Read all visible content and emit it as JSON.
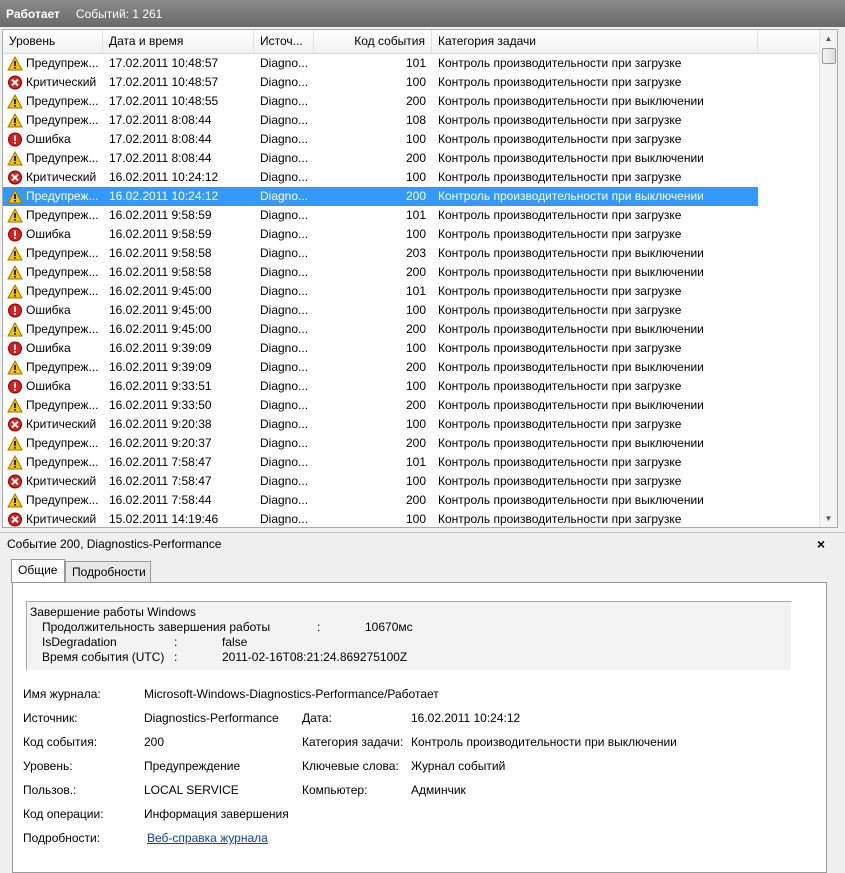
{
  "status": {
    "state": "Работает",
    "events": "Событий: 1 261"
  },
  "columns": [
    "Уровень",
    "Дата и время",
    "Источ...",
    "Код события",
    "Категория задачи"
  ],
  "rows": [
    {
      "level": "Предупреж...",
      "icon": "warning-icon",
      "date": "17.02.2011 10:48:57",
      "source": "Diagno...",
      "code": "101",
      "category": "Контроль производительности при загрузке"
    },
    {
      "level": "Критический",
      "icon": "critical-icon",
      "date": "17.02.2011 10:48:57",
      "source": "Diagno...",
      "code": "100",
      "category": "Контроль производительности при загрузке"
    },
    {
      "level": "Предупреж...",
      "icon": "warning-icon",
      "date": "17.02.2011 10:48:55",
      "source": "Diagno...",
      "code": "200",
      "category": "Контроль производительности при выключении"
    },
    {
      "level": "Предупреж...",
      "icon": "warning-icon",
      "date": "17.02.2011 8:08:44",
      "source": "Diagno...",
      "code": "108",
      "category": "Контроль производительности при загрузке"
    },
    {
      "level": "Ошибка",
      "icon": "error-icon",
      "date": "17.02.2011 8:08:44",
      "source": "Diagno...",
      "code": "100",
      "category": "Контроль производительности при загрузке"
    },
    {
      "level": "Предупреж...",
      "icon": "warning-icon",
      "date": "17.02.2011 8:08:44",
      "source": "Diagno...",
      "code": "200",
      "category": "Контроль производительности при выключении"
    },
    {
      "level": "Критический",
      "icon": "critical-icon",
      "date": "16.02.2011 10:24:12",
      "source": "Diagno...",
      "code": "100",
      "category": "Контроль производительности при загрузке"
    },
    {
      "level": "Предупреж...",
      "icon": "warning-icon",
      "date": "16.02.2011 10:24:12",
      "source": "Diagno...",
      "code": "200",
      "category": "Контроль производительности при выключении",
      "selected": true
    },
    {
      "level": "Предупреж...",
      "icon": "warning-icon",
      "date": "16.02.2011 9:58:59",
      "source": "Diagno...",
      "code": "101",
      "category": "Контроль производительности при загрузке"
    },
    {
      "level": "Ошибка",
      "icon": "error-icon",
      "date": "16.02.2011 9:58:59",
      "source": "Diagno...",
      "code": "100",
      "category": "Контроль производительности при загрузке"
    },
    {
      "level": "Предупреж...",
      "icon": "warning-icon",
      "date": "16.02.2011 9:58:58",
      "source": "Diagno...",
      "code": "203",
      "category": "Контроль производительности при выключении"
    },
    {
      "level": "Предупреж...",
      "icon": "warning-icon",
      "date": "16.02.2011 9:58:58",
      "source": "Diagno...",
      "code": "200",
      "category": "Контроль производительности при выключении"
    },
    {
      "level": "Предупреж...",
      "icon": "warning-icon",
      "date": "16.02.2011 9:45:00",
      "source": "Diagno...",
      "code": "101",
      "category": "Контроль производительности при загрузке"
    },
    {
      "level": "Ошибка",
      "icon": "error-icon",
      "date": "16.02.2011 9:45:00",
      "source": "Diagno...",
      "code": "100",
      "category": "Контроль производительности при загрузке"
    },
    {
      "level": "Предупреж...",
      "icon": "warning-icon",
      "date": "16.02.2011 9:45:00",
      "source": "Diagno...",
      "code": "200",
      "category": "Контроль производительности при выключении"
    },
    {
      "level": "Ошибка",
      "icon": "error-icon",
      "date": "16.02.2011 9:39:09",
      "source": "Diagno...",
      "code": "100",
      "category": "Контроль производительности при загрузке"
    },
    {
      "level": "Предупреж...",
      "icon": "warning-icon",
      "date": "16.02.2011 9:39:09",
      "source": "Diagno...",
      "code": "200",
      "category": "Контроль производительности при выключении"
    },
    {
      "level": "Ошибка",
      "icon": "error-icon",
      "date": "16.02.2011 9:33:51",
      "source": "Diagno...",
      "code": "100",
      "category": "Контроль производительности при загрузке"
    },
    {
      "level": "Предупреж...",
      "icon": "warning-icon",
      "date": "16.02.2011 9:33:50",
      "source": "Diagno...",
      "code": "200",
      "category": "Контроль производительности при выключении"
    },
    {
      "level": "Критический",
      "icon": "critical-icon",
      "date": "16.02.2011 9:20:38",
      "source": "Diagno...",
      "code": "100",
      "category": "Контроль производительности при загрузке"
    },
    {
      "level": "Предупреж...",
      "icon": "warning-icon",
      "date": "16.02.2011 9:20:37",
      "source": "Diagno...",
      "code": "200",
      "category": "Контроль производительности при выключении"
    },
    {
      "level": "Предупреж...",
      "icon": "warning-icon",
      "date": "16.02.2011 7:58:47",
      "source": "Diagno...",
      "code": "101",
      "category": "Контроль производительности при загрузке"
    },
    {
      "level": "Критический",
      "icon": "critical-icon",
      "date": "16.02.2011 7:58:47",
      "source": "Diagno...",
      "code": "100",
      "category": "Контроль производительности при загрузке"
    },
    {
      "level": "Предупреж...",
      "icon": "warning-icon",
      "date": "16.02.2011 7:58:44",
      "source": "Diagno...",
      "code": "200",
      "category": "Контроль производительности при выключении"
    },
    {
      "level": "Критический",
      "icon": "critical-icon",
      "date": "15.02.2011 14:19:46",
      "source": "Diagno...",
      "code": "100",
      "category": "Контроль производительности при загрузке"
    }
  ],
  "detail": {
    "title": "Событие 200, Diagnostics-Performance",
    "close": "×",
    "tabs": [
      "Общие",
      "Подробности"
    ],
    "message": {
      "line1": "Завершение работы Windows",
      "k1": "Продолжительность завершения работы",
      "sep1": ":",
      "v1": "10670мс",
      "k2": "IsDegradation",
      "sep2": ":",
      "v2": "false",
      "k3": "Время события (UTC)",
      "sep3": ":",
      "v3": "2011-02-16T08:21:24.869275100Z"
    },
    "fields": {
      "log_label": "Имя журнала:",
      "log_value": "Microsoft-Windows-Diagnostics-Performance/Работает",
      "source_label": "Источник:",
      "source_value": "Diagnostics-Performance",
      "date_label": "Дата:",
      "date_value": "16.02.2011 10:24:12",
      "code_label": "Код события:",
      "code_value": "200",
      "category_label": "Категория задачи:",
      "category_value": "Контроль производительности при выключении",
      "level_label": "Уровень:",
      "level_value": "Предупреждение",
      "keywords_label": "Ключевые слова:",
      "keywords_value": "Журнал событий",
      "user_label": "Пользов.:",
      "user_value": "LOCAL SERVICE",
      "computer_label": "Компьютер:",
      "computer_value": "Админчик",
      "opcode_label": "Код операции:",
      "opcode_value": "Информация завершения",
      "details_label": "Подробности:",
      "details_link": "Веб-справка журнала"
    }
  },
  "colors": {
    "selection": "#3399ff",
    "warning": "#f5c400",
    "error": "#d62020",
    "link": "#0645ad"
  }
}
